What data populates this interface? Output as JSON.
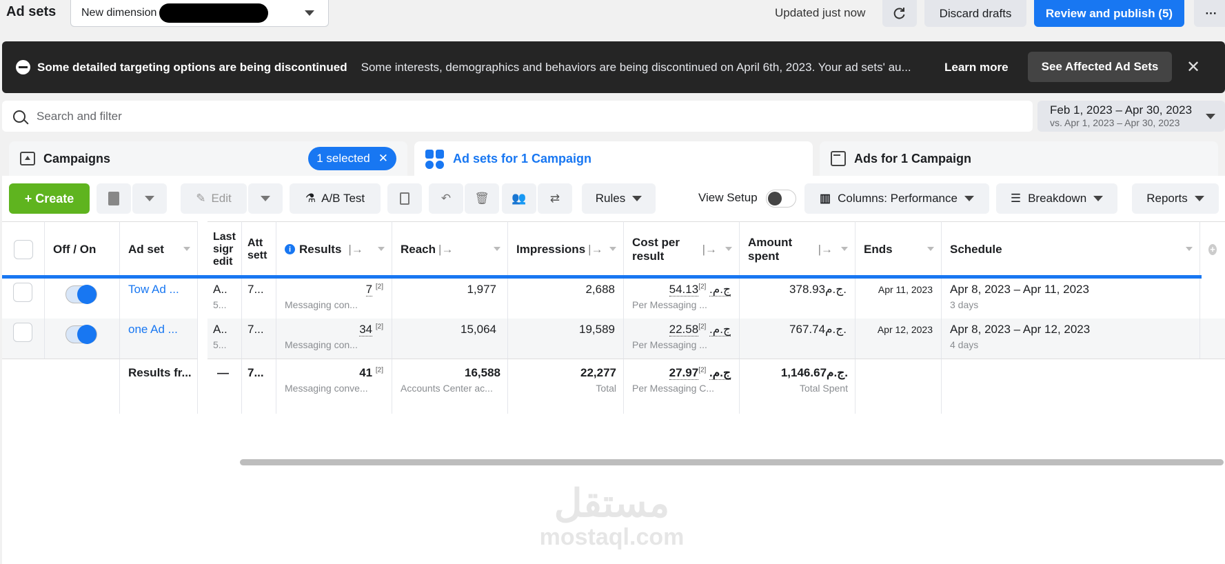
{
  "header": {
    "title": "Ad sets",
    "dimension_label": "New dimension",
    "updated": "Updated just now",
    "discard": "Discard drafts",
    "publish": "Review and publish (5)",
    "more": "···"
  },
  "banner": {
    "title": "Some detailed targeting options are being discontinued",
    "message": "Some interests, demographics and behaviors are being discontinued on April 6th, 2023. Your ad sets' au...",
    "learn_more": "Learn more",
    "affected": "See Affected Ad Sets",
    "close": "✕"
  },
  "search": {
    "placeholder": "Search and filter"
  },
  "date_range": {
    "main": "Feb 1, 2023 – Apr 30, 2023",
    "compare": "vs. Apr 1, 2023 – Apr 30, 2023"
  },
  "tabs": {
    "campaigns": "Campaigns",
    "selected": "1 selected",
    "selected_clear": "✕",
    "adsets": "Ad sets for 1 Campaign",
    "ads": "Ads for 1 Campaign"
  },
  "toolbar": {
    "create": "+  Create",
    "edit": "Edit",
    "ab_test": "A/B Test",
    "rules": "Rules",
    "view_setup": "View Setup",
    "columns": "Columns: Performance",
    "breakdown": "Breakdown",
    "reports": "Reports"
  },
  "table": {
    "headers": {
      "offon": "Off / On",
      "adset": "Ad set",
      "last": "Last sigr edit",
      "attr": "Att sett",
      "results": "Results",
      "reach": "Reach",
      "impressions": "Impressions",
      "cost": "Cost per result",
      "spent": "Amount spent",
      "ends": "Ends",
      "schedule": "Schedule"
    },
    "rows": [
      {
        "name": "Tow Ad ...",
        "last": "A..",
        "last_sub": "5...",
        "attr": "7...",
        "results": "7",
        "results_sub": "Messaging con...",
        "reach": "1,977",
        "impressions": "2,688",
        "cost": "54.13ج.م.",
        "cost_sub": "Per Messaging ...",
        "spent": "378.93ج.م.",
        "ends": "Apr 11, 2023",
        "schedule": "Apr 8, 2023 – Apr 11, 2023",
        "schedule_sub": "3 days"
      },
      {
        "name": "one Ad ...",
        "last": "A..",
        "last_sub": "5...",
        "attr": "7...",
        "results": "34",
        "results_sub": "Messaging con...",
        "reach": "15,064",
        "impressions": "19,589",
        "cost": "22.58ج.م.",
        "cost_sub": "Per Messaging ...",
        "spent": "767.74ج.م.",
        "ends": "Apr 12, 2023",
        "schedule": "Apr 8, 2023 – Apr 12, 2023",
        "schedule_sub": "4 days"
      }
    ],
    "total": {
      "name": "Results fr...",
      "last": "—",
      "attr": "7...",
      "results": "41",
      "results_sub": "Messaging conve...",
      "reach": "16,588",
      "reach_sub": "Accounts Center ac...",
      "impressions": "22,277",
      "impressions_sub": "Total",
      "cost": "27.97ج.م.",
      "cost_sub": "Per Messaging C...",
      "spent": "1,146.67ج.م.",
      "spent_sub": "Total Spent"
    },
    "footnote": "[2]"
  },
  "watermark": {
    "arabic": "مستقل",
    "latin": "mostaql.com"
  },
  "colors": {
    "accent": "#1877f2",
    "create": "#5fb41f",
    "banner": "#252525"
  }
}
